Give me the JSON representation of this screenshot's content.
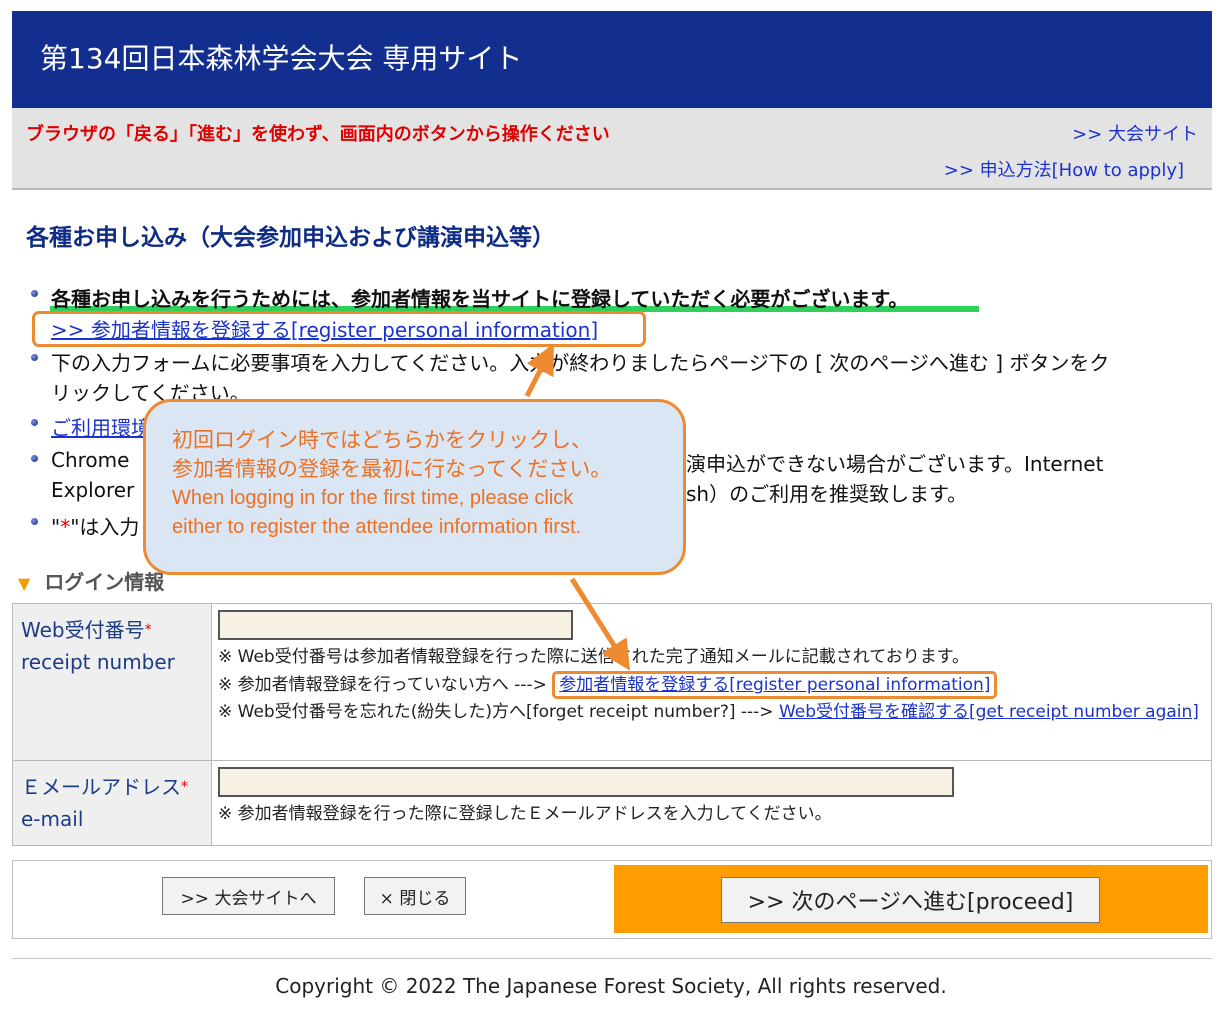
{
  "header": {
    "title": "第134回日本森林学会大会 専用サイト"
  },
  "notice": {
    "warning": "ブラウザの「戻る」「進む」を使わず、画面内のボタンから操作ください",
    "link_conference_site": ">> 大会サイト",
    "link_how_to_apply": ">> 申込方法[How to apply]"
  },
  "main": {
    "section_title": "各種お申し込み（大会参加申込および講演申込等）",
    "bullets": {
      "b1_text": "各種お申し込みを行うためには、参加者情報を当サイトに登録していただく必要がございます。",
      "b1_link": ">> 参加者情報を登録する[register personal information]",
      "b2_line1": "下の入力フォームに必要事項を入力してください。入力が終わりましたらページ下の [ 次のページへ進む ] ボタンをク",
      "b2_line2": "リックしてください。",
      "b3_link": "ご利用環境",
      "b4_line1_start": "Chrome",
      "b4_line1_end": "演申込ができない場合がございます。Internet",
      "b4_line2_start": "Explorer",
      "b4_line2_end": "sh）のご利用を推奨致します。",
      "b5_start": "\"",
      "b5_star": "*",
      "b5_end": "\"は入力"
    }
  },
  "callout": {
    "jp_line1": "初回ログイン時ではどちらかをクリックし、",
    "jp_line2": "参加者情報の登録を最初に行なってください。",
    "en_line1": "When logging in for the first time, please click",
    "en_line2": "either to register the attendee information first."
  },
  "login": {
    "heading": "ログイン情報",
    "receipt": {
      "label_jp": "Web受付番号",
      "label_en": "receipt number",
      "required_mark": "*",
      "value": "",
      "note1": "※ Web受付番号は参加者情報登録を行った際に送信された完了通知メールに記載されております。",
      "note2_prefix": "※ 参加者情報登録を行っていない方へ --->",
      "note2_link": "参加者情報を登録する[register personal information]",
      "note3_prefix": "※ Web受付番号を忘れた(紛失した)方へ[forget receipt number?] --->",
      "note3_link": "Web受付番号を確認する[get receipt number again]"
    },
    "email": {
      "label_jp": "Ｅメールアドレス",
      "label_en": "e-mail",
      "required_mark": "*",
      "value": "",
      "note": "※ 参加者情報登録を行った際に登録したＥメールアドレスを入力してください。"
    }
  },
  "buttons": {
    "to_site": ">> 大会サイトへ",
    "close": "× 閉じる",
    "proceed": ">> 次のページへ進む[proceed]"
  },
  "footer": {
    "copyright": "Copyright © 2022 The Japanese Forest Society, All rights reserved."
  },
  "colors": {
    "header_bg": "#122f8f",
    "warning": "#e00000",
    "accent_orange": "#ee8a30",
    "proceed_bg": "#ff9c00",
    "highlight_green": "#2fd15a"
  }
}
